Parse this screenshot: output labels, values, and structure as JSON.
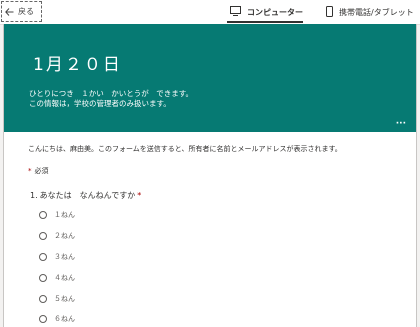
{
  "topbar": {
    "back_label": "戻る",
    "computer_label": "コンピューター",
    "mobile_label": "携帯電話/タブレット"
  },
  "banner": {
    "title": "1月２０日",
    "desc_line1": "ひとりにつき　１かい　かいとうが　できます。",
    "desc_line2": "この情報は，学校の管理者のみ扱います。",
    "color": "#067a73"
  },
  "form": {
    "greeting": "こんにちは、麻由美。このフォームを送信すると、所有者に名前とメールアドレスが表示されます。",
    "required_star": "*",
    "required_label": "必須",
    "question": {
      "number": "1.",
      "text": "あなたは　なんねんですか",
      "required_star": "*",
      "options": [
        "１ねん",
        "２ねん",
        "３ねん",
        "４ねん",
        "５ねん",
        "６ねん"
      ]
    }
  }
}
